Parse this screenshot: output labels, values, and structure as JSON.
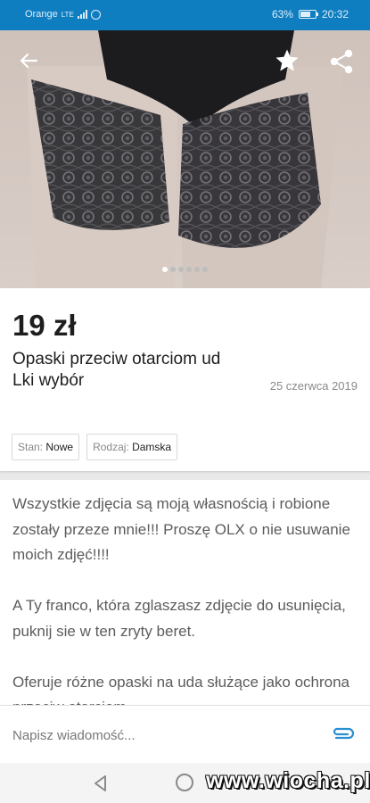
{
  "status_bar": {
    "carrier": "Orange",
    "network": "LTE",
    "battery": "63%",
    "battery_level": 0.63,
    "time": "20:32"
  },
  "gallery": {
    "photo_count": 6,
    "active_index": 0,
    "icons": {
      "back": "arrow-left-icon",
      "favorite": "star-icon",
      "share": "share-icon"
    }
  },
  "listing": {
    "price": "19 zł",
    "title": "Opaski przeciw otarciom ud\nLki wybór",
    "date": "25 czerwca 2019",
    "params": [
      {
        "key": "Stan:",
        "value": "Nowe"
      },
      {
        "key": "Rodzaj:",
        "value": "Damska"
      }
    ],
    "description": "Wszystkie zdjęcia są moją własnością i robione zostały przeze mnie!!! Proszę OLX o nie usuwanie moich zdjęć!!!!\n\nA Ty franco, która zglaszasz zdjęcie do usunięcia, puknij sie w ten zryty beret.\n\nOferuje różne opaski na uda służące jako ochrona przeciw otarciom"
  },
  "message_bar": {
    "placeholder": "Napisz wiadomość...",
    "attach_icon": "paperclip-icon"
  },
  "nav_bar": {
    "icons": [
      "nav-back-icon",
      "nav-home-icon"
    ]
  },
  "watermark": "www.wiocha.pl",
  "colors": {
    "status_bar": "#0f7ec0",
    "attach": "#2a8fd0"
  }
}
